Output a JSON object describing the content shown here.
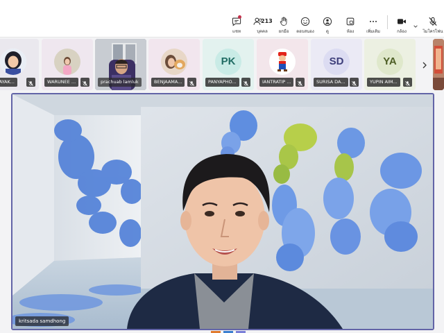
{
  "toolbar": {
    "items": [
      {
        "label": "แชท",
        "icon": "chat-icon"
      },
      {
        "label": "บุคคล",
        "icon": "people-icon",
        "count": "213"
      },
      {
        "label": "ยกมือ",
        "icon": "raise-hand-icon"
      },
      {
        "label": "ตอบสนอง",
        "icon": "react-icon"
      },
      {
        "label": "ดู",
        "icon": "view-icon"
      },
      {
        "label": "ห้อง",
        "icon": "rooms-icon"
      },
      {
        "label": "เพิ่มเติม",
        "icon": "more-icon"
      },
      {
        "label": "กล้อง",
        "icon": "camera-icon"
      },
      {
        "label": "ไมโครโฟน",
        "icon": "mic-off-icon"
      }
    ]
  },
  "participants": [
    {
      "name": "NLAYAK...",
      "type": "photo"
    },
    {
      "name": "WARUNEE ...",
      "type": "photo"
    },
    {
      "name": "prachuab lamluk",
      "type": "photo"
    },
    {
      "name": "BENJAAMA...",
      "type": "photo"
    },
    {
      "name": "PANYAPHO...",
      "type": "initials",
      "initials": "PK"
    },
    {
      "name": "IANTRATIP ...",
      "type": "photo"
    },
    {
      "name": "SURISA DA...",
      "type": "initials",
      "initials": "SD"
    },
    {
      "name": "YUPIN AIM...",
      "type": "initials",
      "initials": "YA"
    }
  ],
  "main_video": {
    "speaker": "kritsada samdhong"
  },
  "colors": {
    "accent": "#6264a7",
    "muted_red": "#c4314b",
    "tile_bg": "#efe8f3"
  }
}
